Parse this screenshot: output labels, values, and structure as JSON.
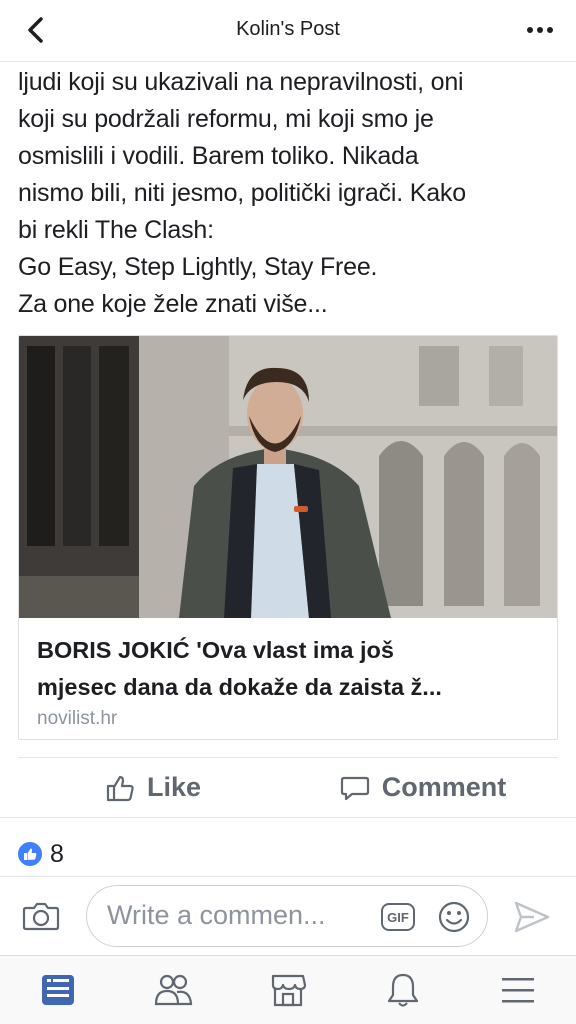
{
  "header": {
    "title": "Kolin's Post",
    "back_icon": "chevron-left-icon",
    "more_icon": "more-dots-icon"
  },
  "post": {
    "lines": [
      "ljudi koji su ukazivali na nepravilnosti, oni",
      "koji su podržali reformu, mi koji smo je",
      "osmislili i vodili. Barem toliko. Nikada",
      "nismo bili, niti jesmo, politički igrači. Kako",
      "bi rekli The Clash:",
      "Go Easy, Step Lightly, Stay Free.",
      "Za one koje žele znati više..."
    ]
  },
  "link_card": {
    "headline_line1": "BORIS JOKIĆ 'Ova vlast ima još",
    "headline_line2": "mjesec dana da dokaže da zaista ž...",
    "domain": "novilist.hr"
  },
  "actions": {
    "like_label": "Like",
    "comment_label": "Comment"
  },
  "reactions": {
    "count": "8",
    "icon": "thumbs-up-badge-icon",
    "color": "#4080ff"
  },
  "composer": {
    "placeholder": "Write a commen...",
    "gif_label": "GIF"
  },
  "tabbar": {
    "items": [
      "news-feed-icon",
      "friends-icon",
      "marketplace-icon",
      "notifications-icon",
      "menu-icon"
    ],
    "active_color": "#4267b2"
  }
}
